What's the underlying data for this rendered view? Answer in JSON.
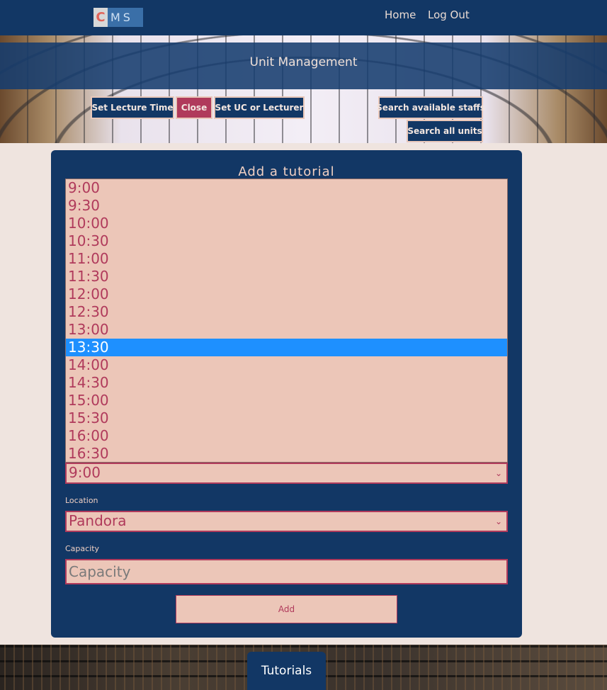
{
  "header": {
    "logo": {
      "first": "C",
      "rest": "MS"
    },
    "nav": {
      "home": "Home",
      "logout": "Log Out"
    }
  },
  "banner": {
    "title": "Unit Management",
    "buttons": {
      "set_lecture_time": "Set Lecture Time",
      "close": "Close",
      "set_uc_lecturer": "Set UC or Lecturer",
      "search_staffs": "Search available staffs",
      "search_units": "Search all units"
    }
  },
  "form": {
    "title": "Add a tutorial",
    "time_options": [
      "9:00",
      "9:30",
      "10:00",
      "10:30",
      "11:00",
      "11:30",
      "12:00",
      "12:30",
      "13:00",
      "13:30",
      "14:00",
      "14:30",
      "15:00",
      "15:30",
      "16:00",
      "16:30"
    ],
    "highlighted_option": "13:30",
    "time_select_value": "9:00",
    "location_label": "Location",
    "location_value": "Pandora",
    "capacity_label": "Capacity",
    "capacity_placeholder": "Capacity",
    "add_label": "Add"
  },
  "footer": {
    "tab": "Tutorials"
  },
  "colors": {
    "navy": "#123765",
    "rose": "#b03a5b",
    "peach": "#ecc6b8",
    "highlight": "#1e90ff",
    "page_bg": "#efe4df"
  }
}
